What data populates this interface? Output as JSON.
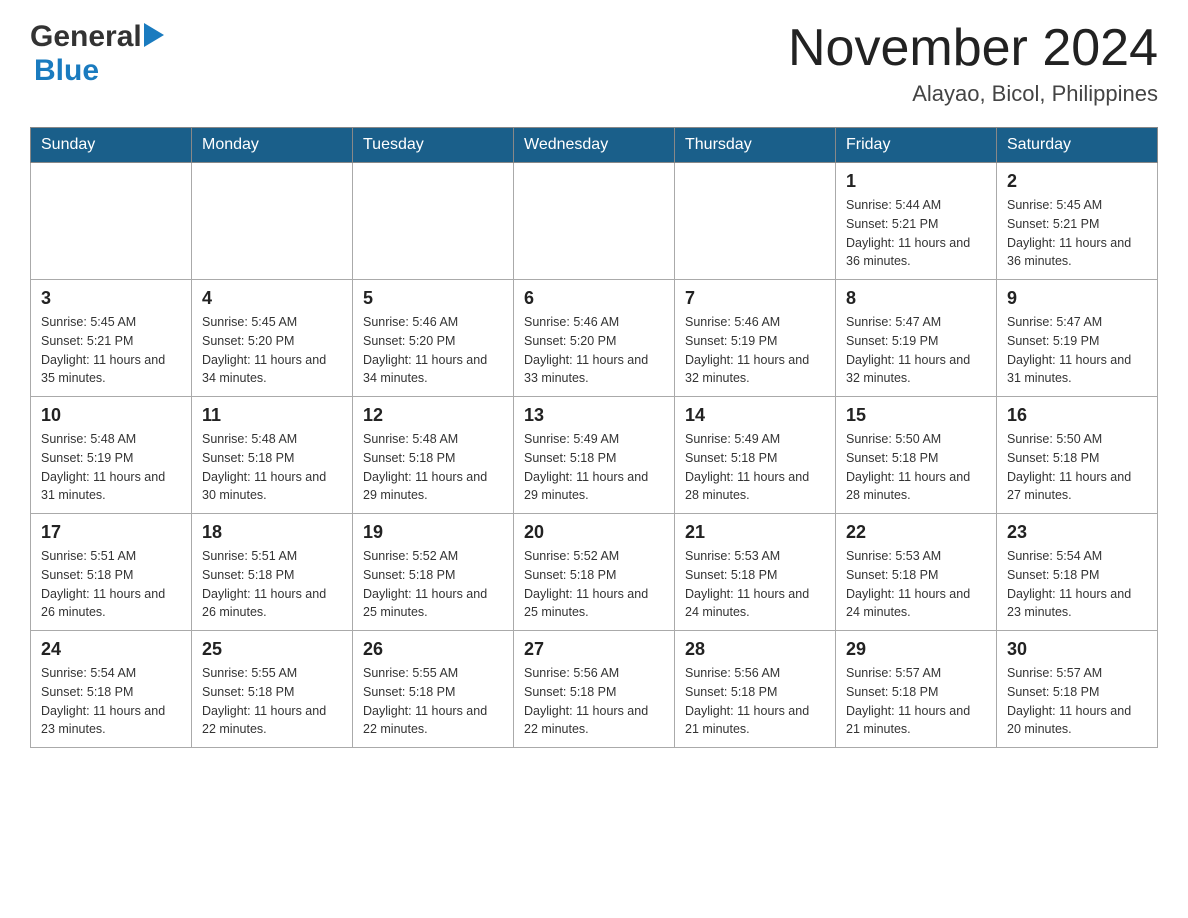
{
  "header": {
    "month_year": "November 2024",
    "location": "Alayao, Bicol, Philippines",
    "logo_general": "General",
    "logo_blue": "Blue"
  },
  "weekdays": [
    "Sunday",
    "Monday",
    "Tuesday",
    "Wednesday",
    "Thursday",
    "Friday",
    "Saturday"
  ],
  "weeks": [
    {
      "days": [
        {
          "number": "",
          "info": ""
        },
        {
          "number": "",
          "info": ""
        },
        {
          "number": "",
          "info": ""
        },
        {
          "number": "",
          "info": ""
        },
        {
          "number": "",
          "info": ""
        },
        {
          "number": "1",
          "info": "Sunrise: 5:44 AM\nSunset: 5:21 PM\nDaylight: 11 hours and 36 minutes."
        },
        {
          "number": "2",
          "info": "Sunrise: 5:45 AM\nSunset: 5:21 PM\nDaylight: 11 hours and 36 minutes."
        }
      ]
    },
    {
      "days": [
        {
          "number": "3",
          "info": "Sunrise: 5:45 AM\nSunset: 5:21 PM\nDaylight: 11 hours and 35 minutes."
        },
        {
          "number": "4",
          "info": "Sunrise: 5:45 AM\nSunset: 5:20 PM\nDaylight: 11 hours and 34 minutes."
        },
        {
          "number": "5",
          "info": "Sunrise: 5:46 AM\nSunset: 5:20 PM\nDaylight: 11 hours and 34 minutes."
        },
        {
          "number": "6",
          "info": "Sunrise: 5:46 AM\nSunset: 5:20 PM\nDaylight: 11 hours and 33 minutes."
        },
        {
          "number": "7",
          "info": "Sunrise: 5:46 AM\nSunset: 5:19 PM\nDaylight: 11 hours and 32 minutes."
        },
        {
          "number": "8",
          "info": "Sunrise: 5:47 AM\nSunset: 5:19 PM\nDaylight: 11 hours and 32 minutes."
        },
        {
          "number": "9",
          "info": "Sunrise: 5:47 AM\nSunset: 5:19 PM\nDaylight: 11 hours and 31 minutes."
        }
      ]
    },
    {
      "days": [
        {
          "number": "10",
          "info": "Sunrise: 5:48 AM\nSunset: 5:19 PM\nDaylight: 11 hours and 31 minutes."
        },
        {
          "number": "11",
          "info": "Sunrise: 5:48 AM\nSunset: 5:18 PM\nDaylight: 11 hours and 30 minutes."
        },
        {
          "number": "12",
          "info": "Sunrise: 5:48 AM\nSunset: 5:18 PM\nDaylight: 11 hours and 29 minutes."
        },
        {
          "number": "13",
          "info": "Sunrise: 5:49 AM\nSunset: 5:18 PM\nDaylight: 11 hours and 29 minutes."
        },
        {
          "number": "14",
          "info": "Sunrise: 5:49 AM\nSunset: 5:18 PM\nDaylight: 11 hours and 28 minutes."
        },
        {
          "number": "15",
          "info": "Sunrise: 5:50 AM\nSunset: 5:18 PM\nDaylight: 11 hours and 28 minutes."
        },
        {
          "number": "16",
          "info": "Sunrise: 5:50 AM\nSunset: 5:18 PM\nDaylight: 11 hours and 27 minutes."
        }
      ]
    },
    {
      "days": [
        {
          "number": "17",
          "info": "Sunrise: 5:51 AM\nSunset: 5:18 PM\nDaylight: 11 hours and 26 minutes."
        },
        {
          "number": "18",
          "info": "Sunrise: 5:51 AM\nSunset: 5:18 PM\nDaylight: 11 hours and 26 minutes."
        },
        {
          "number": "19",
          "info": "Sunrise: 5:52 AM\nSunset: 5:18 PM\nDaylight: 11 hours and 25 minutes."
        },
        {
          "number": "20",
          "info": "Sunrise: 5:52 AM\nSunset: 5:18 PM\nDaylight: 11 hours and 25 minutes."
        },
        {
          "number": "21",
          "info": "Sunrise: 5:53 AM\nSunset: 5:18 PM\nDaylight: 11 hours and 24 minutes."
        },
        {
          "number": "22",
          "info": "Sunrise: 5:53 AM\nSunset: 5:18 PM\nDaylight: 11 hours and 24 minutes."
        },
        {
          "number": "23",
          "info": "Sunrise: 5:54 AM\nSunset: 5:18 PM\nDaylight: 11 hours and 23 minutes."
        }
      ]
    },
    {
      "days": [
        {
          "number": "24",
          "info": "Sunrise: 5:54 AM\nSunset: 5:18 PM\nDaylight: 11 hours and 23 minutes."
        },
        {
          "number": "25",
          "info": "Sunrise: 5:55 AM\nSunset: 5:18 PM\nDaylight: 11 hours and 22 minutes."
        },
        {
          "number": "26",
          "info": "Sunrise: 5:55 AM\nSunset: 5:18 PM\nDaylight: 11 hours and 22 minutes."
        },
        {
          "number": "27",
          "info": "Sunrise: 5:56 AM\nSunset: 5:18 PM\nDaylight: 11 hours and 22 minutes."
        },
        {
          "number": "28",
          "info": "Sunrise: 5:56 AM\nSunset: 5:18 PM\nDaylight: 11 hours and 21 minutes."
        },
        {
          "number": "29",
          "info": "Sunrise: 5:57 AM\nSunset: 5:18 PM\nDaylight: 11 hours and 21 minutes."
        },
        {
          "number": "30",
          "info": "Sunrise: 5:57 AM\nSunset: 5:18 PM\nDaylight: 11 hours and 20 minutes."
        }
      ]
    }
  ]
}
